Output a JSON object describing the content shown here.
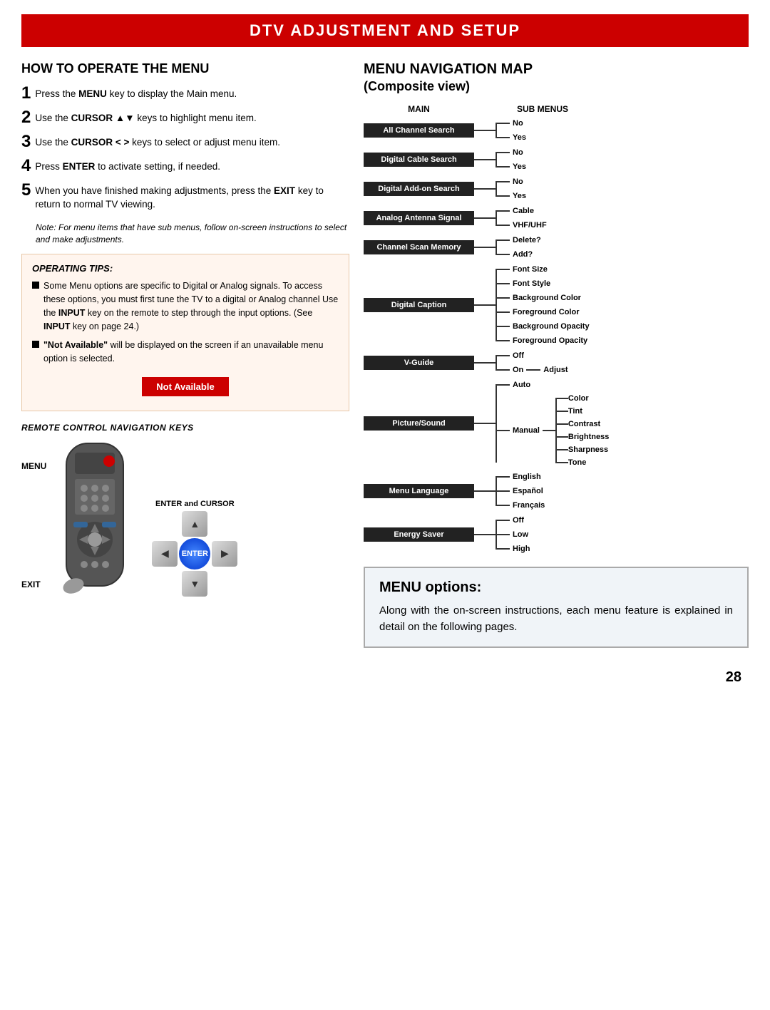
{
  "header": {
    "title": "DTV ADJUSTMENT AND SETUP"
  },
  "left": {
    "how_to_title": "HOW TO OPERATE THE MENU",
    "steps": [
      {
        "num": "1",
        "text": "Press the <b>MENU</b> key to display the Main menu."
      },
      {
        "num": "2",
        "text": "Use the <b>CURSOR ▲▼</b> keys to highlight menu item."
      },
      {
        "num": "3",
        "text": "Use the <b>CURSOR < ></b> keys to select or adjust menu item."
      },
      {
        "num": "4",
        "text": "Press <b>ENTER</b> to activate setting, if needed."
      },
      {
        "num": "5",
        "text": "When you have finished making adjustments, press the <b>EXIT</b> key to return to normal TV viewing."
      }
    ],
    "note": "Note: For menu items that have sub menus, follow on-screen instructions to select and make adjustments.",
    "tips_title": "OPERATING TIPS:",
    "tips": [
      "Some Menu options are specific to Digital or Analog signals. To access these options, you must first tune the TV to a digital or Analog channel Use the INPUT key on the remote to step through the input options. (See INPUT key on page 24.)",
      "\"Not Available\" will be displayed on the screen if an unavailable menu option is selected."
    ],
    "not_available_label": "Not Available",
    "remote_nav_title": "REMOTE CONTROL NAVIGATION KEYS",
    "menu_label": "MENU",
    "exit_label": "EXIT",
    "enter_cursor_label": "ENTER and CURSOR",
    "enter_label": "ENTER"
  },
  "right": {
    "nav_map_title": "MENU NAVIGATION MAP",
    "nav_map_subtitle": "(Composite view)",
    "main_label": "MAIN",
    "sub_menus_label": "SUB MENUS",
    "menu_items": [
      {
        "main": "All Channel Search",
        "subs": [
          "No",
          "Yes"
        ]
      },
      {
        "main": "Digital Cable Search",
        "subs": [
          "No",
          "Yes"
        ]
      },
      {
        "main": "Digital Add-on Search",
        "subs": [
          "No",
          "Yes"
        ]
      },
      {
        "main": "Analog Antenna Signal",
        "subs": [
          "Cable",
          "VHF/UHF"
        ]
      },
      {
        "main": "Channel Scan Memory",
        "subs": [
          "Delete?",
          "Add?"
        ]
      },
      {
        "main": "Digital Caption",
        "subs": [
          "Font Size",
          "Font Style",
          "Background Color",
          "Foreground Color",
          "Background Opacity",
          "Foreground Opacity"
        ]
      },
      {
        "main": "V-Guide",
        "subs": [
          "Off",
          "On"
        ],
        "on_adjust": "Adjust"
      },
      {
        "main": "Picture/Sound",
        "subs": [
          "Auto",
          "Manual"
        ],
        "manual_subs": [
          "Color",
          "Tint",
          "Contrast",
          "Brightness",
          "Sharpness",
          "Tone"
        ]
      },
      {
        "main": "Menu Language",
        "subs": [
          "English",
          "Español",
          "Français"
        ]
      },
      {
        "main": "Energy Saver",
        "subs": [
          "Off",
          "Low",
          "High"
        ]
      }
    ],
    "menu_options_title": "MENU options:",
    "menu_options_text": "Along with the on-screen instructions, each menu feature is explained in detail on the following pages."
  },
  "page_number": "28"
}
